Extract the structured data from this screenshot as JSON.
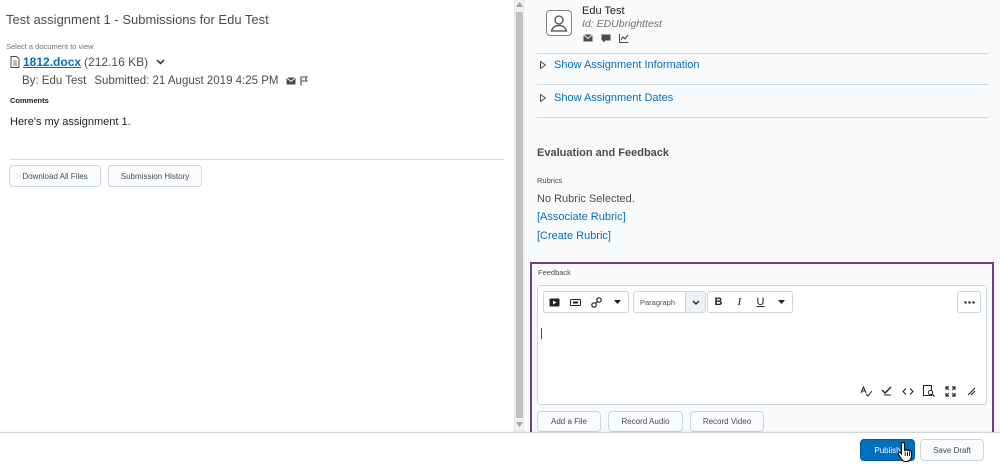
{
  "left": {
    "title": "Test assignment 1 - Submissions for Edu Test",
    "select_doc_label": "Select a document to view",
    "file": {
      "name": "1812.docx",
      "size": "(212.16 KB)"
    },
    "by": "By: Edu Test",
    "submitted": "Submitted: 21 August 2019 4:25 PM",
    "comments_label": "Comments",
    "comments_text": "Here's my assignment 1.",
    "buttons": {
      "download_all": "Download All Files",
      "history": "Submission History"
    }
  },
  "user": {
    "name": "Edu Test",
    "id": "Id: EDUbrighttest"
  },
  "sections": {
    "assignment_info": "Show Assignment Information",
    "assignment_dates": "Show Assignment Dates"
  },
  "evaluation": {
    "heading": "Evaluation and Feedback",
    "rubrics_label": "Rubrics",
    "no_rubric": "No Rubric Selected.",
    "associate": "[Associate Rubric]",
    "create": "[Create Rubric]"
  },
  "feedback": {
    "label": "Feedback",
    "format_value": "Paragraph",
    "text_buttons": {
      "bold": "B",
      "italic": "I",
      "underline": "U"
    },
    "attach": {
      "add_file": "Add a File",
      "record_audio": "Record Audio",
      "record_video": "Record Video"
    }
  },
  "footer": {
    "publish": "Publish",
    "save_draft": "Save Draft"
  },
  "colors": {
    "accent": "#006fbf",
    "highlight_border": "#6e3d8f",
    "text": "#494c4e"
  }
}
